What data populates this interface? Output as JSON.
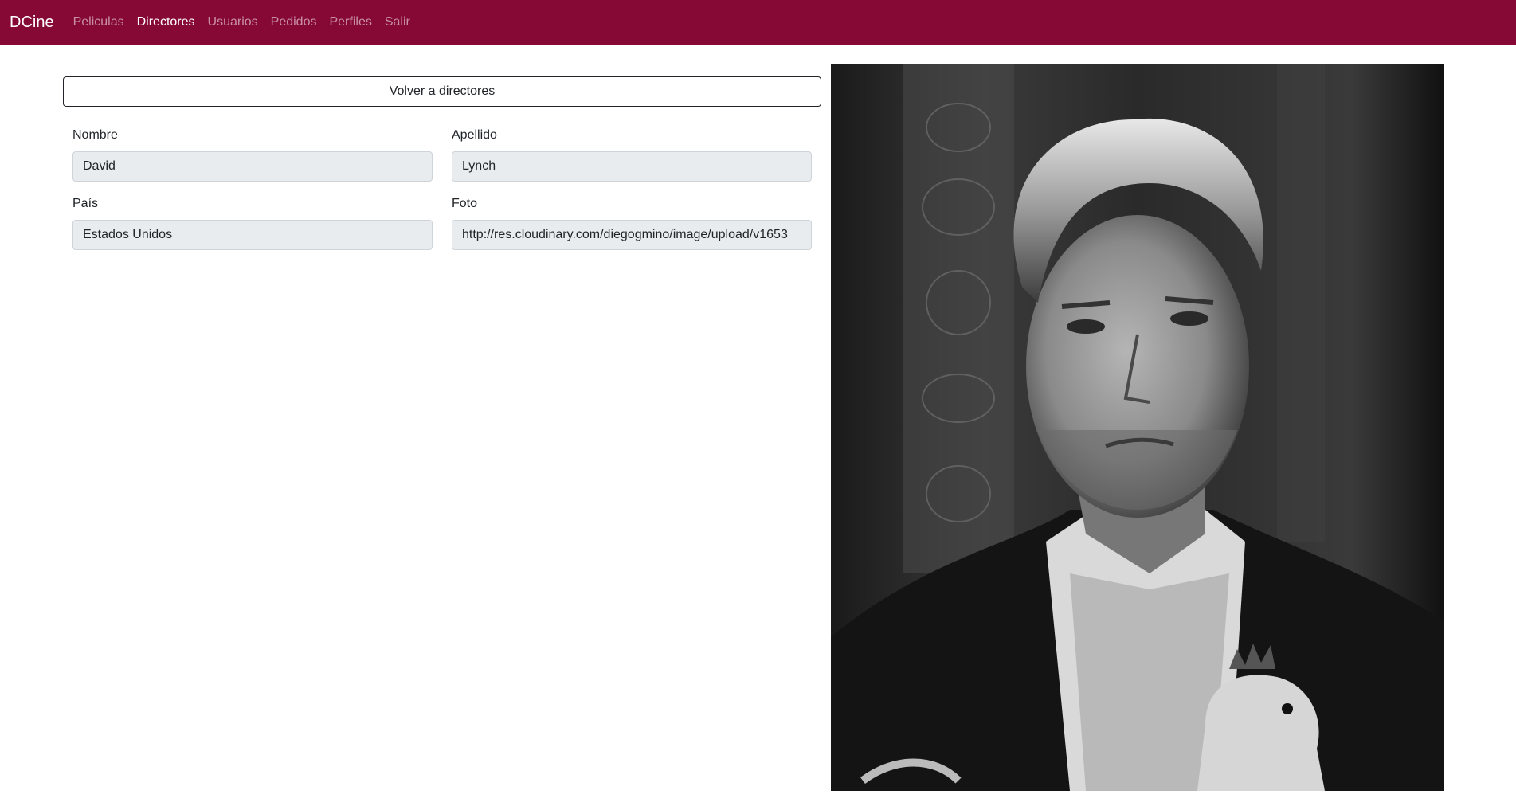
{
  "navbar": {
    "brand": "DCine",
    "links": [
      {
        "label": "Peliculas",
        "active": false
      },
      {
        "label": "Directores",
        "active": true
      },
      {
        "label": "Usuarios",
        "active": false
      },
      {
        "label": "Pedidos",
        "active": false
      },
      {
        "label": "Perfiles",
        "active": false
      },
      {
        "label": "Salir",
        "active": false
      }
    ],
    "background_color": "#850835"
  },
  "back_button": {
    "label": "Volver a directores"
  },
  "form": {
    "nombre": {
      "label": "Nombre",
      "value": "David"
    },
    "apellido": {
      "label": "Apellido",
      "value": "Lynch"
    },
    "pais": {
      "label": "País",
      "value": "Estados Unidos"
    },
    "foto": {
      "label": "Foto",
      "value": "http://res.cloudinary.com/diegogmino/image/upload/v1653"
    }
  },
  "photo": {
    "icon": "director-portrait-image"
  }
}
